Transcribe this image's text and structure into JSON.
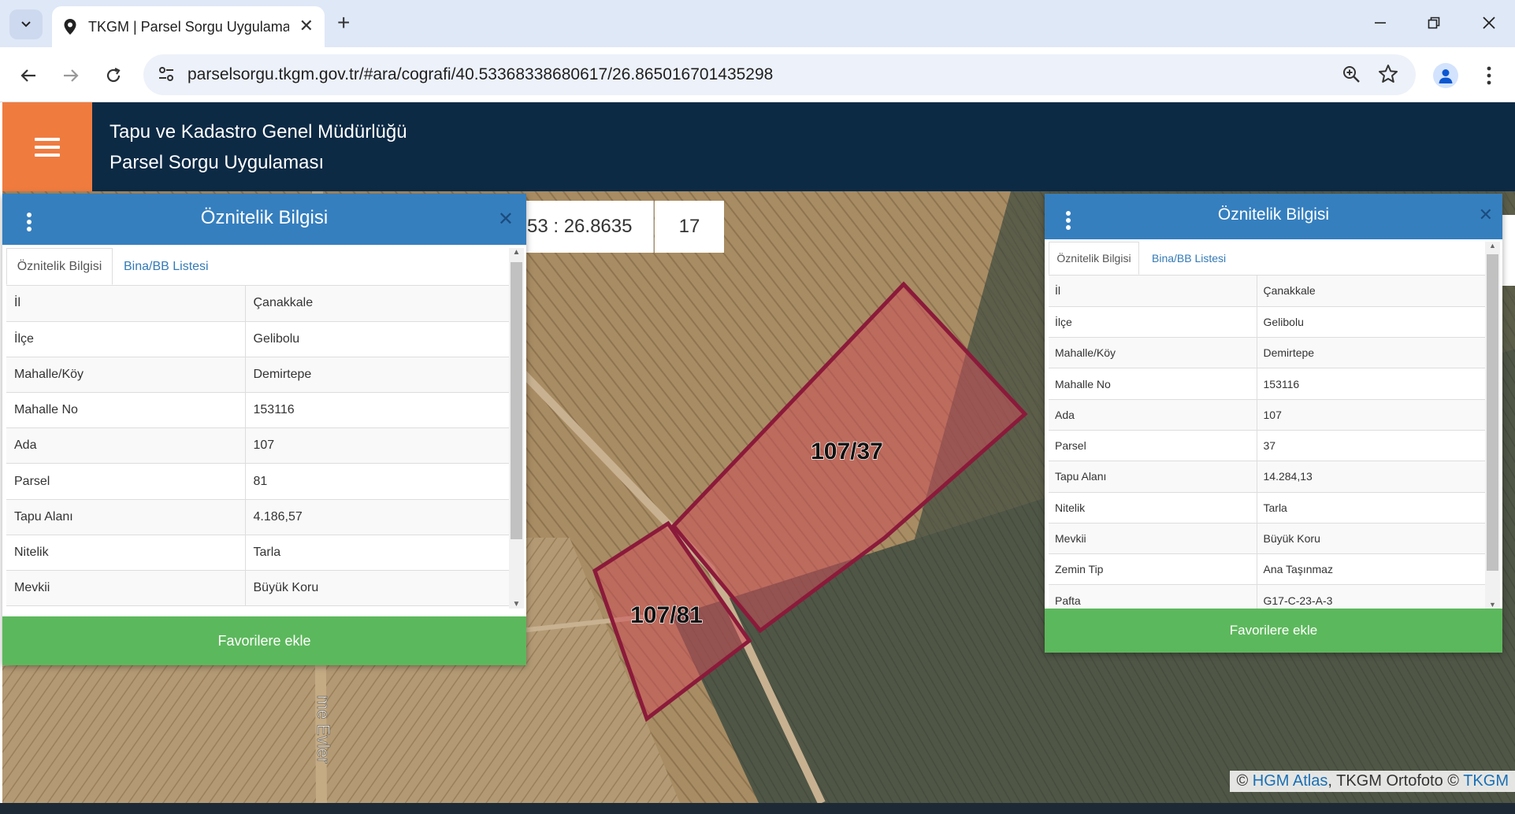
{
  "browser": {
    "tab_title": "TKGM | Parsel Sorgu Uygulaması",
    "url": "parselsorgu.tkgm.gov.tr/#ara/cografi/40.53368338680617/26.865016701435298"
  },
  "app": {
    "title_line1": "Tapu ve Kadastro Genel Müdürlüğü",
    "title_line2": "Parsel Sorgu Uygulaması"
  },
  "map": {
    "coordinate_readout": "53 : 26.8635",
    "zoom_level": "17",
    "parcel_labels": [
      "107/37",
      "107/81"
    ],
    "parcel_color": "#8b1a3a",
    "road_label": "me Evler",
    "attribution": {
      "prefix": "©",
      "link1": "HGM Atlas",
      "middle": ", TKGM Ortofoto ©",
      "link2": "TKGM"
    }
  },
  "panel_left": {
    "title": "Öznitelik Bilgisi",
    "tabs": [
      "Öznitelik Bilgisi",
      "Bina/BB Listesi"
    ],
    "rows": [
      [
        "İl",
        "Çanakkale"
      ],
      [
        "İlçe",
        "Gelibolu"
      ],
      [
        "Mahalle/Köy",
        "Demirtepe"
      ],
      [
        "Mahalle No",
        "153116"
      ],
      [
        "Ada",
        "107"
      ],
      [
        "Parsel",
        "81"
      ],
      [
        "Tapu Alanı",
        "4.186,57"
      ],
      [
        "Nitelik",
        "Tarla"
      ],
      [
        "Mevkii",
        "Büyük Koru"
      ]
    ],
    "button": "Favorilere ekle"
  },
  "panel_right": {
    "title": "Öznitelik Bilgisi",
    "tabs": [
      "Öznitelik Bilgisi",
      "Bina/BB Listesi"
    ],
    "rows": [
      [
        "İl",
        "Çanakkale"
      ],
      [
        "İlçe",
        "Gelibolu"
      ],
      [
        "Mahalle/Köy",
        "Demirtepe"
      ],
      [
        "Mahalle No",
        "153116"
      ],
      [
        "Ada",
        "107"
      ],
      [
        "Parsel",
        "37"
      ],
      [
        "Tapu Alanı",
        "14.284,13"
      ],
      [
        "Nitelik",
        "Tarla"
      ],
      [
        "Mevkii",
        "Büyük Koru"
      ],
      [
        "Zemin Tip",
        "Ana Taşınmaz"
      ],
      [
        "Pafta",
        "G17-C-23-A-3"
      ]
    ],
    "button": "Favorilere ekle"
  },
  "colors": {
    "header_bg": "#0d2a45",
    "menu_accent": "#f07b3f",
    "panel_header": "#357fbf",
    "favorite_button": "#5cb85c"
  }
}
